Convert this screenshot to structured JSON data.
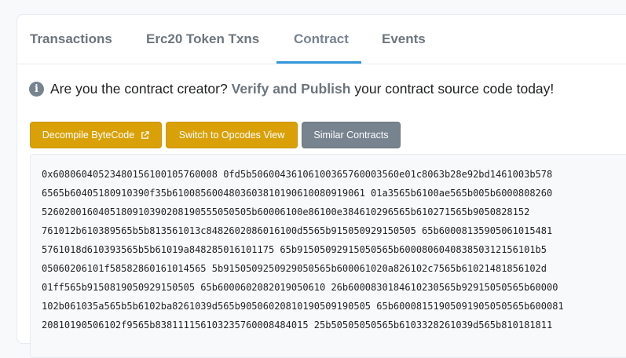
{
  "tabs": [
    {
      "label": "Transactions"
    },
    {
      "label": "Erc20 Token Txns"
    },
    {
      "label": "Contract"
    },
    {
      "label": "Events"
    }
  ],
  "notice": {
    "icon": "info-circle-icon",
    "prefix": "Are you the contract creator?",
    "link": "Verify and Publish",
    "suffix": "your contract source code today!"
  },
  "buttons": {
    "decompile": "Decompile ByteCode",
    "opcodes": "Switch to Opcodes View",
    "similar": "Similar Contracts"
  },
  "bytecode": [
    "0x60806040523480156100105760008 0fd5b50600436106100365760003560e01c8063b28e92bd1461003b578",
    "6565b60405180910390f35b6100856004803603810190610080919061 01a3565b6100ae565b005b6000808260",
    "5260200160405180910390208190555050505b60006100e86100e384610296565b610271565b9050828152",
    "761012b610389565b5b813561013c8482602086016100d5565b915050929150505 65b60008135905061015481",
    "5761018d610393565b5b61019a848285016101175 65b91505092915050565b600080604083850312156101b5",
    "05060206101f58582860161014565 5b9150509250929050565b600061020a826102c7565b61021481856102d",
    "01ff565b9150819050929150505 65b6000602082019050610 26b6000830184610230565b92915050565b60000",
    "102b061035a565b5b6102ba8261039d565b90506020810190509190505 65b60008151905091905050565b600081",
    "20810190506102f9565b838111156103235760008484015 25b50505050565b6103328261039d565b810181811"
  ],
  "colors": {
    "accent": "#3498db",
    "warning": "#d9a008",
    "secondary": "#77838f"
  }
}
